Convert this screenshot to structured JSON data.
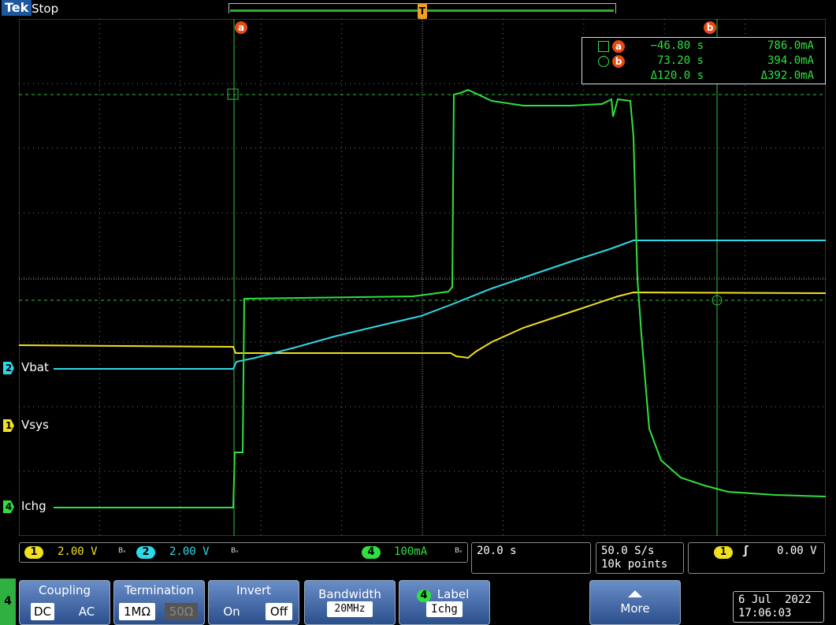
{
  "header": {
    "logo": "Tek",
    "run_state": "Stop",
    "trigger_marker": "T"
  },
  "cursor_readout": {
    "cursor_a": {
      "badge": "a",
      "time": "−46.80 s",
      "value": "786.0mA"
    },
    "cursor_b": {
      "badge": "b",
      "time": "73.20 s",
      "value": "394.0mA"
    },
    "delta": {
      "time": "Δ120.0 s",
      "value": "Δ392.0mA"
    },
    "cursor_a_label": "a",
    "cursor_b_label": "b"
  },
  "channels": [
    {
      "num": "2",
      "name": "Vbat",
      "color": "#2fd8e8"
    },
    {
      "num": "1",
      "name": "Vsys",
      "color": "#f0e020"
    },
    {
      "num": "4",
      "name": "Ichg",
      "color": "#2fe040"
    }
  ],
  "status": {
    "ch1": {
      "num": "1",
      "scale": "2.00 V",
      "color": "#f0e020"
    },
    "ch2": {
      "num": "2",
      "scale": "2.00 V",
      "color": "#2fd8e8"
    },
    "ch4": {
      "num": "4",
      "scale": "100mA",
      "color": "#2fe040"
    },
    "bw_mark": "Bᵥ",
    "timebase": "20.0 s",
    "sample_rate": "50.0 S/s",
    "record_length": "10k points",
    "trigger": {
      "source": "1",
      "slope": "ʃ",
      "level": "0.00 V"
    }
  },
  "menu": {
    "channel_tab": "4",
    "coupling": {
      "title": "Coupling",
      "options": [
        "DC",
        "AC"
      ],
      "selected": "DC"
    },
    "termination": {
      "title": "Termination",
      "options": [
        "1MΩ",
        "50Ω"
      ],
      "selected": "1MΩ"
    },
    "invert": {
      "title": "Invert",
      "options": [
        "On",
        "Off"
      ],
      "selected": "Off"
    },
    "bandwidth": {
      "title": "Bandwidth",
      "value": "20MHz"
    },
    "label": {
      "title": "Label",
      "channel": "4",
      "value": "Ichg"
    },
    "more": {
      "title": "More"
    }
  },
  "datetime": {
    "date": "6 Jul  2022",
    "time": "17:06:03"
  }
}
